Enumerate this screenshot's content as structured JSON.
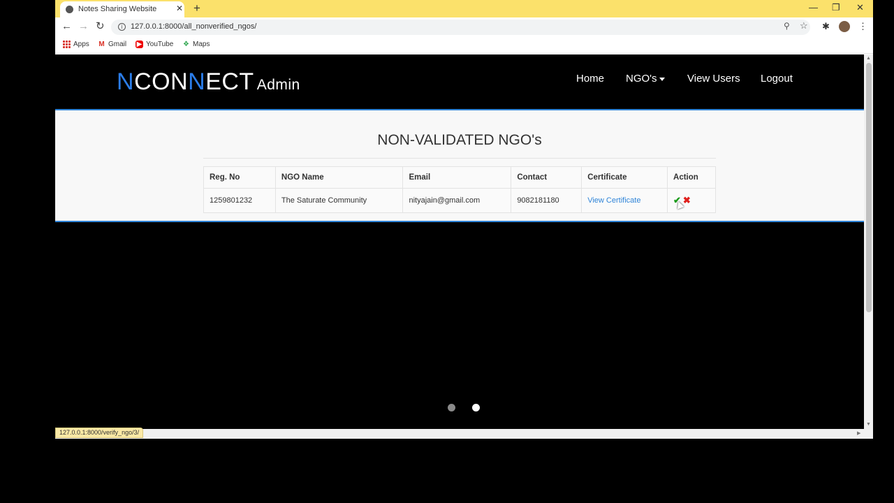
{
  "browser": {
    "tab_title": "Notes Sharing Website",
    "tab_close": "✕",
    "new_tab": "+",
    "window_controls": {
      "minimize": "—",
      "maximize": "❐",
      "close": "✕"
    },
    "url": "127.0.0.1:8000/all_nonverified_ngos/",
    "bookmarks": [
      {
        "label": "Apps",
        "icon": "apps-icon"
      },
      {
        "label": "Gmail",
        "icon": "gmail-icon"
      },
      {
        "label": "YouTube",
        "icon": "youtube-icon"
      },
      {
        "label": "Maps",
        "icon": "maps-icon"
      }
    ],
    "status_url": "127.0.0.1:8000/verify_ngo/3/"
  },
  "site": {
    "logo": {
      "n1": "N",
      "con": "CON",
      "n2": "N",
      "ect": "ECT",
      "suffix": "Admin"
    },
    "nav": {
      "home": "Home",
      "ngos": "NGO's",
      "view_users": "View Users",
      "logout": "Logout"
    }
  },
  "page": {
    "title": "NON-VALIDATED NGO's",
    "table": {
      "headers": [
        "Reg. No",
        "NGO Name",
        "Email",
        "Contact",
        "Certificate",
        "Action"
      ],
      "rows": [
        {
          "reg_no": "1259801232",
          "name": "The Saturate Community",
          "email": "nityajain@gmail.com",
          "contact": "9082181180",
          "certificate": "View Certificate",
          "approve_glyph": "✔",
          "reject_glyph": "✖"
        }
      ]
    }
  },
  "carousel": {
    "active_index": 1,
    "count": 2
  },
  "colors": {
    "accent": "#2f84d8",
    "logo_blue": "#2b7de9",
    "tab_bar": "#fbe16b",
    "approve": "#1a9b1a",
    "reject": "#e0201c"
  }
}
